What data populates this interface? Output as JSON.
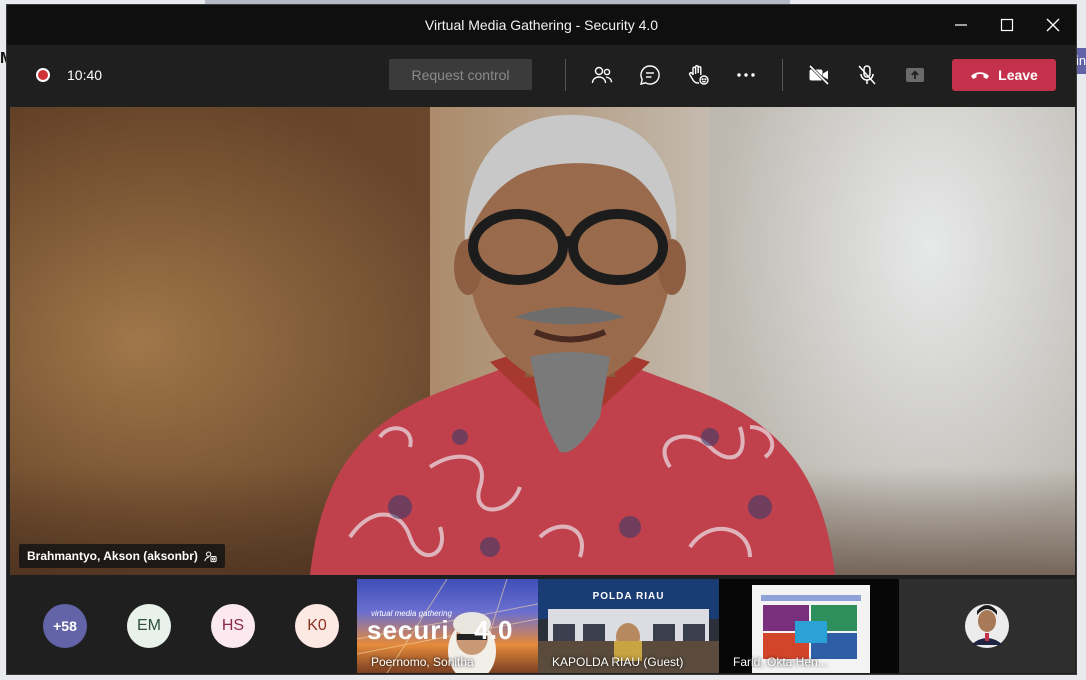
{
  "window": {
    "title": "Virtual Media Gathering - Security 4.0"
  },
  "toolbar": {
    "timer": "10:40",
    "request_control": "Request control",
    "leave": "Leave",
    "icons": [
      "participants-icon",
      "chat-icon",
      "raise-hand-icon",
      "more-icon",
      "camera-off-icon",
      "mic-off-icon",
      "share-tray-icon"
    ]
  },
  "stage": {
    "speaker_name": "Brahmantyo, Akson (aksonbr)"
  },
  "strip": {
    "overflow_count": "+58",
    "avatars": [
      {
        "initials": "EM",
        "bg": "#e8f1ea",
        "fg": "#2f4f3a"
      },
      {
        "initials": "HS",
        "bg": "#fbe9ef",
        "fg": "#8a2a4b"
      },
      {
        "initials": "K0",
        "bg": "#fde9e4",
        "fg": "#8a3322"
      }
    ],
    "tiles": [
      {
        "name": "Poernomo, Sonitha",
        "banner_small": "virtual media gathering",
        "banner_big": "securi   4.0"
      },
      {
        "name": "KAPOLDA RIAU (Guest)",
        "sign": "POLDA RIAU"
      },
      {
        "name": "Farid, Okta Hen..."
      }
    ]
  },
  "colors": {
    "leave": "#c4314b",
    "overflow_avatar": "#6264a7",
    "record": "#d13438"
  }
}
